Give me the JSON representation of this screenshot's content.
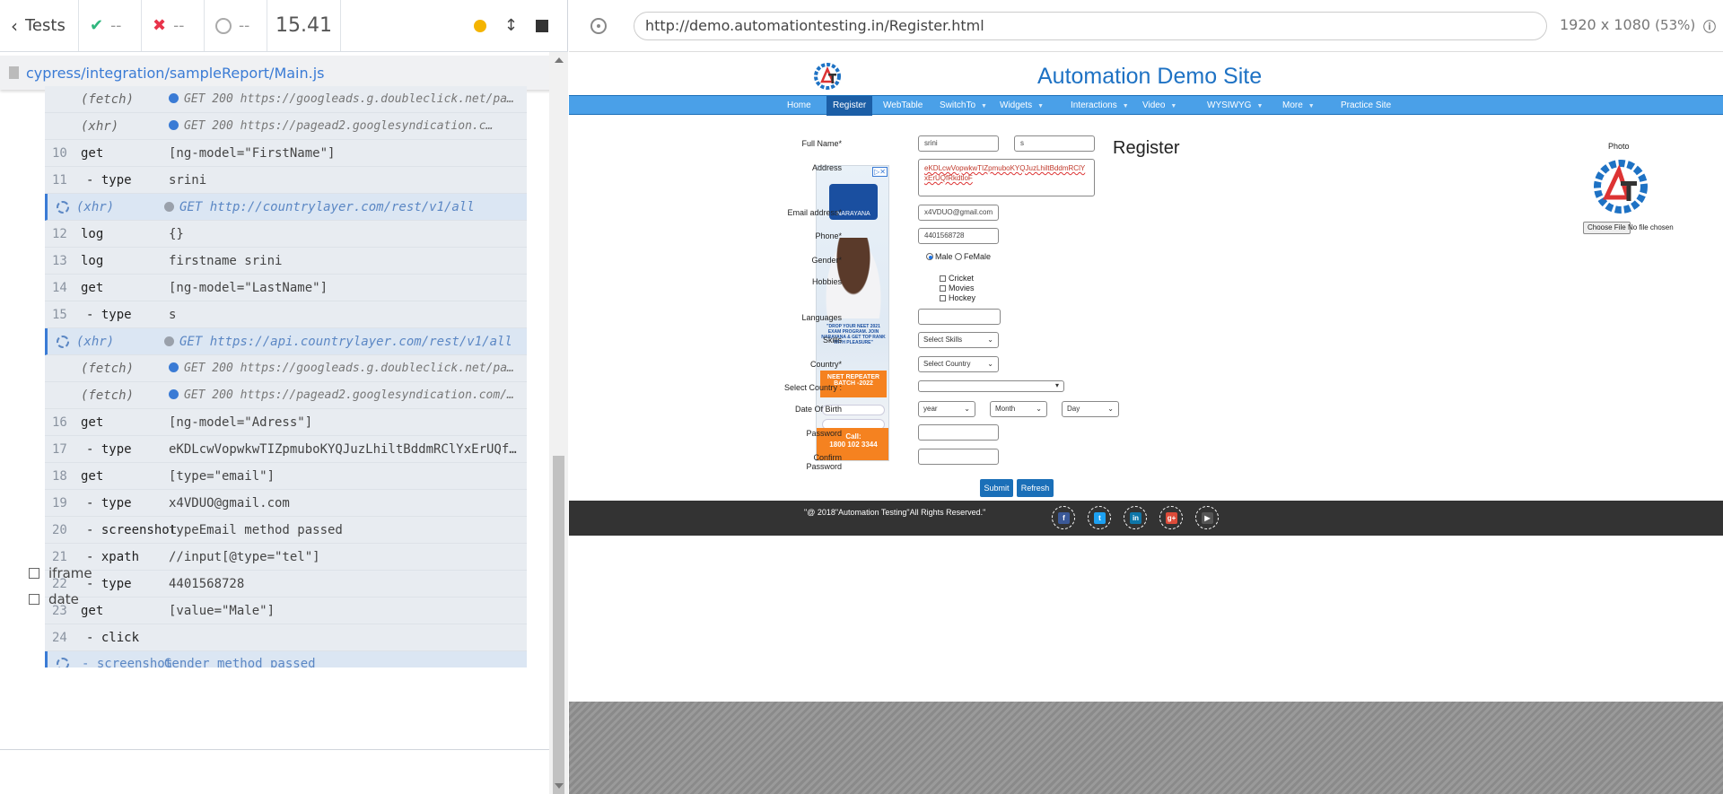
{
  "reporter": {
    "tests_label": "Tests",
    "passed": "--",
    "failed": "--",
    "pending": "--",
    "duration": "15.41",
    "spec_path": "cypress/integration/sampleReport/Main.js",
    "commands": [
      {
        "num": "",
        "name": "(fetch)",
        "msg": "GET 200 https://googleads.g.doubleclick.net/pagead/…",
        "kind": "net"
      },
      {
        "num": "",
        "name": "(xhr)",
        "msg": "GET 200 https://pagead2.googlesyndication.c…",
        "kind": "net"
      },
      {
        "num": "10",
        "name": "get",
        "msg": "[ng-model=\"FirstName\"]",
        "kind": "cmd"
      },
      {
        "num": "11",
        "name": "- type",
        "msg": "srini",
        "kind": "sub"
      },
      {
        "num": "",
        "name": "(xhr)",
        "msg": "GET http://countrylayer.com/rest/v1/all",
        "kind": "pending"
      },
      {
        "num": "12",
        "name": "log",
        "msg": "{}",
        "kind": "cmd"
      },
      {
        "num": "13",
        "name": "log",
        "msg": "firstname srini",
        "kind": "cmd"
      },
      {
        "num": "14",
        "name": "get",
        "msg": "[ng-model=\"LastName\"]",
        "kind": "cmd"
      },
      {
        "num": "15",
        "name": "- type",
        "msg": "s",
        "kind": "sub"
      },
      {
        "num": "",
        "name": "(xhr)",
        "msg": "GET https://api.countrylayer.com/rest/v1/all",
        "kind": "pending"
      },
      {
        "num": "",
        "name": "(fetch)",
        "msg": "GET 200 https://googleads.g.doubleclick.net/pagead/…",
        "kind": "net"
      },
      {
        "num": "",
        "name": "(fetch)",
        "msg": "GET 200 https://pagead2.googlesyndication.com/pcs/a…",
        "kind": "net"
      },
      {
        "num": "16",
        "name": "get",
        "msg": "[ng-model=\"Adress\"]",
        "kind": "cmd"
      },
      {
        "num": "17",
        "name": "- type",
        "msg": "eKDLcwVopwkwTIZpmuboKYQJuzLhiltBddmRClYxErUQfR…",
        "kind": "sub"
      },
      {
        "num": "18",
        "name": "get",
        "msg": "[type=\"email\"]",
        "kind": "cmd"
      },
      {
        "num": "19",
        "name": "- type",
        "msg": "x4VDUO@gmail.com",
        "kind": "sub"
      },
      {
        "num": "20",
        "name": "- screenshot",
        "msg": "typeEmail method passed",
        "kind": "sub"
      },
      {
        "num": "21",
        "name": "- xpath",
        "msg": "//input[@type=\"tel\"]",
        "kind": "sub"
      },
      {
        "num": "22",
        "name": "- type",
        "msg": "4401568728",
        "kind": "sub"
      },
      {
        "num": "23",
        "name": "get",
        "msg": "[value=\"Male\"]",
        "kind": "cmd"
      },
      {
        "num": "24",
        "name": "- click",
        "msg": "",
        "kind": "sub"
      },
      {
        "num": "",
        "name": "- screenshot",
        "msg": "Gender method passed",
        "kind": "pendingsub"
      }
    ],
    "suites": [
      "iframe",
      "date"
    ]
  },
  "browser": {
    "url": "http://demo.automationtesting.in/Register.html",
    "viewport": "1920 x 1080",
    "scale": "(53%)"
  },
  "site": {
    "title": "Automation Demo Site",
    "nav": [
      "Home",
      "Register",
      "WebTable",
      "SwitchTo",
      "Widgets",
      "Interactions",
      "Video",
      "WYSIWYG",
      "More",
      "Practice Site"
    ],
    "nav_active": "Register",
    "heading": "Register",
    "labels": {
      "full_name": "Full Name*",
      "address": "Address",
      "email": "Email address*",
      "phone": "Phone*",
      "gender": "Gender*",
      "hobbies": "Hobbies",
      "languages": "Languages",
      "skills": "Skills",
      "country": "Country*",
      "select_country": "Select Country :",
      "dob": "Date Of Birth",
      "password": "Password",
      "confirm_password_1": "Confirm",
      "confirm_password_2": "Password",
      "photo": "Photo"
    },
    "values": {
      "first_name": "srini",
      "last_name": "s",
      "address": "eKDLcwVopwkwTIZpmuboKYQJuzLhiltBddmRClYxErUQfRkdtloF",
      "email": "x4VDUO@gmail.com",
      "phone": "4401568728"
    },
    "gender_options": [
      "Male",
      "FeMale"
    ],
    "gender_selected": "Male",
    "hobby_options": [
      "Cricket",
      "Movies",
      "Hockey"
    ],
    "skills_select": "Select Skills",
    "country_select": "Select Country",
    "dob_year": "year",
    "dob_month": "Month",
    "dob_day": "Day",
    "submit": "Submit",
    "refresh": "Refresh",
    "file_button": "Choose File",
    "file_status": "No file chosen",
    "footer": "\"@ 2018\"Automation Testing\"All Rights Reserved.\"",
    "ad": {
      "brand": "NARAYANA",
      "tagline": "\"DROP YOUR NEET 2021 EXAM PROGRAM. JOIN NARAYANA & GET TOP RANK WITH PLEASURE\"",
      "promo": "NEET REPEATER BATCH -2022",
      "call": "Call:",
      "phone": "1800 102 3344"
    }
  },
  "colors": {
    "accent": "#3a7bd5",
    "nav": "#4aa0e8",
    "nav_active": "#1b5ea6",
    "title": "#1e72c4",
    "footer": "#333333",
    "pass": "#2eb67d",
    "fail": "#e8334a"
  }
}
